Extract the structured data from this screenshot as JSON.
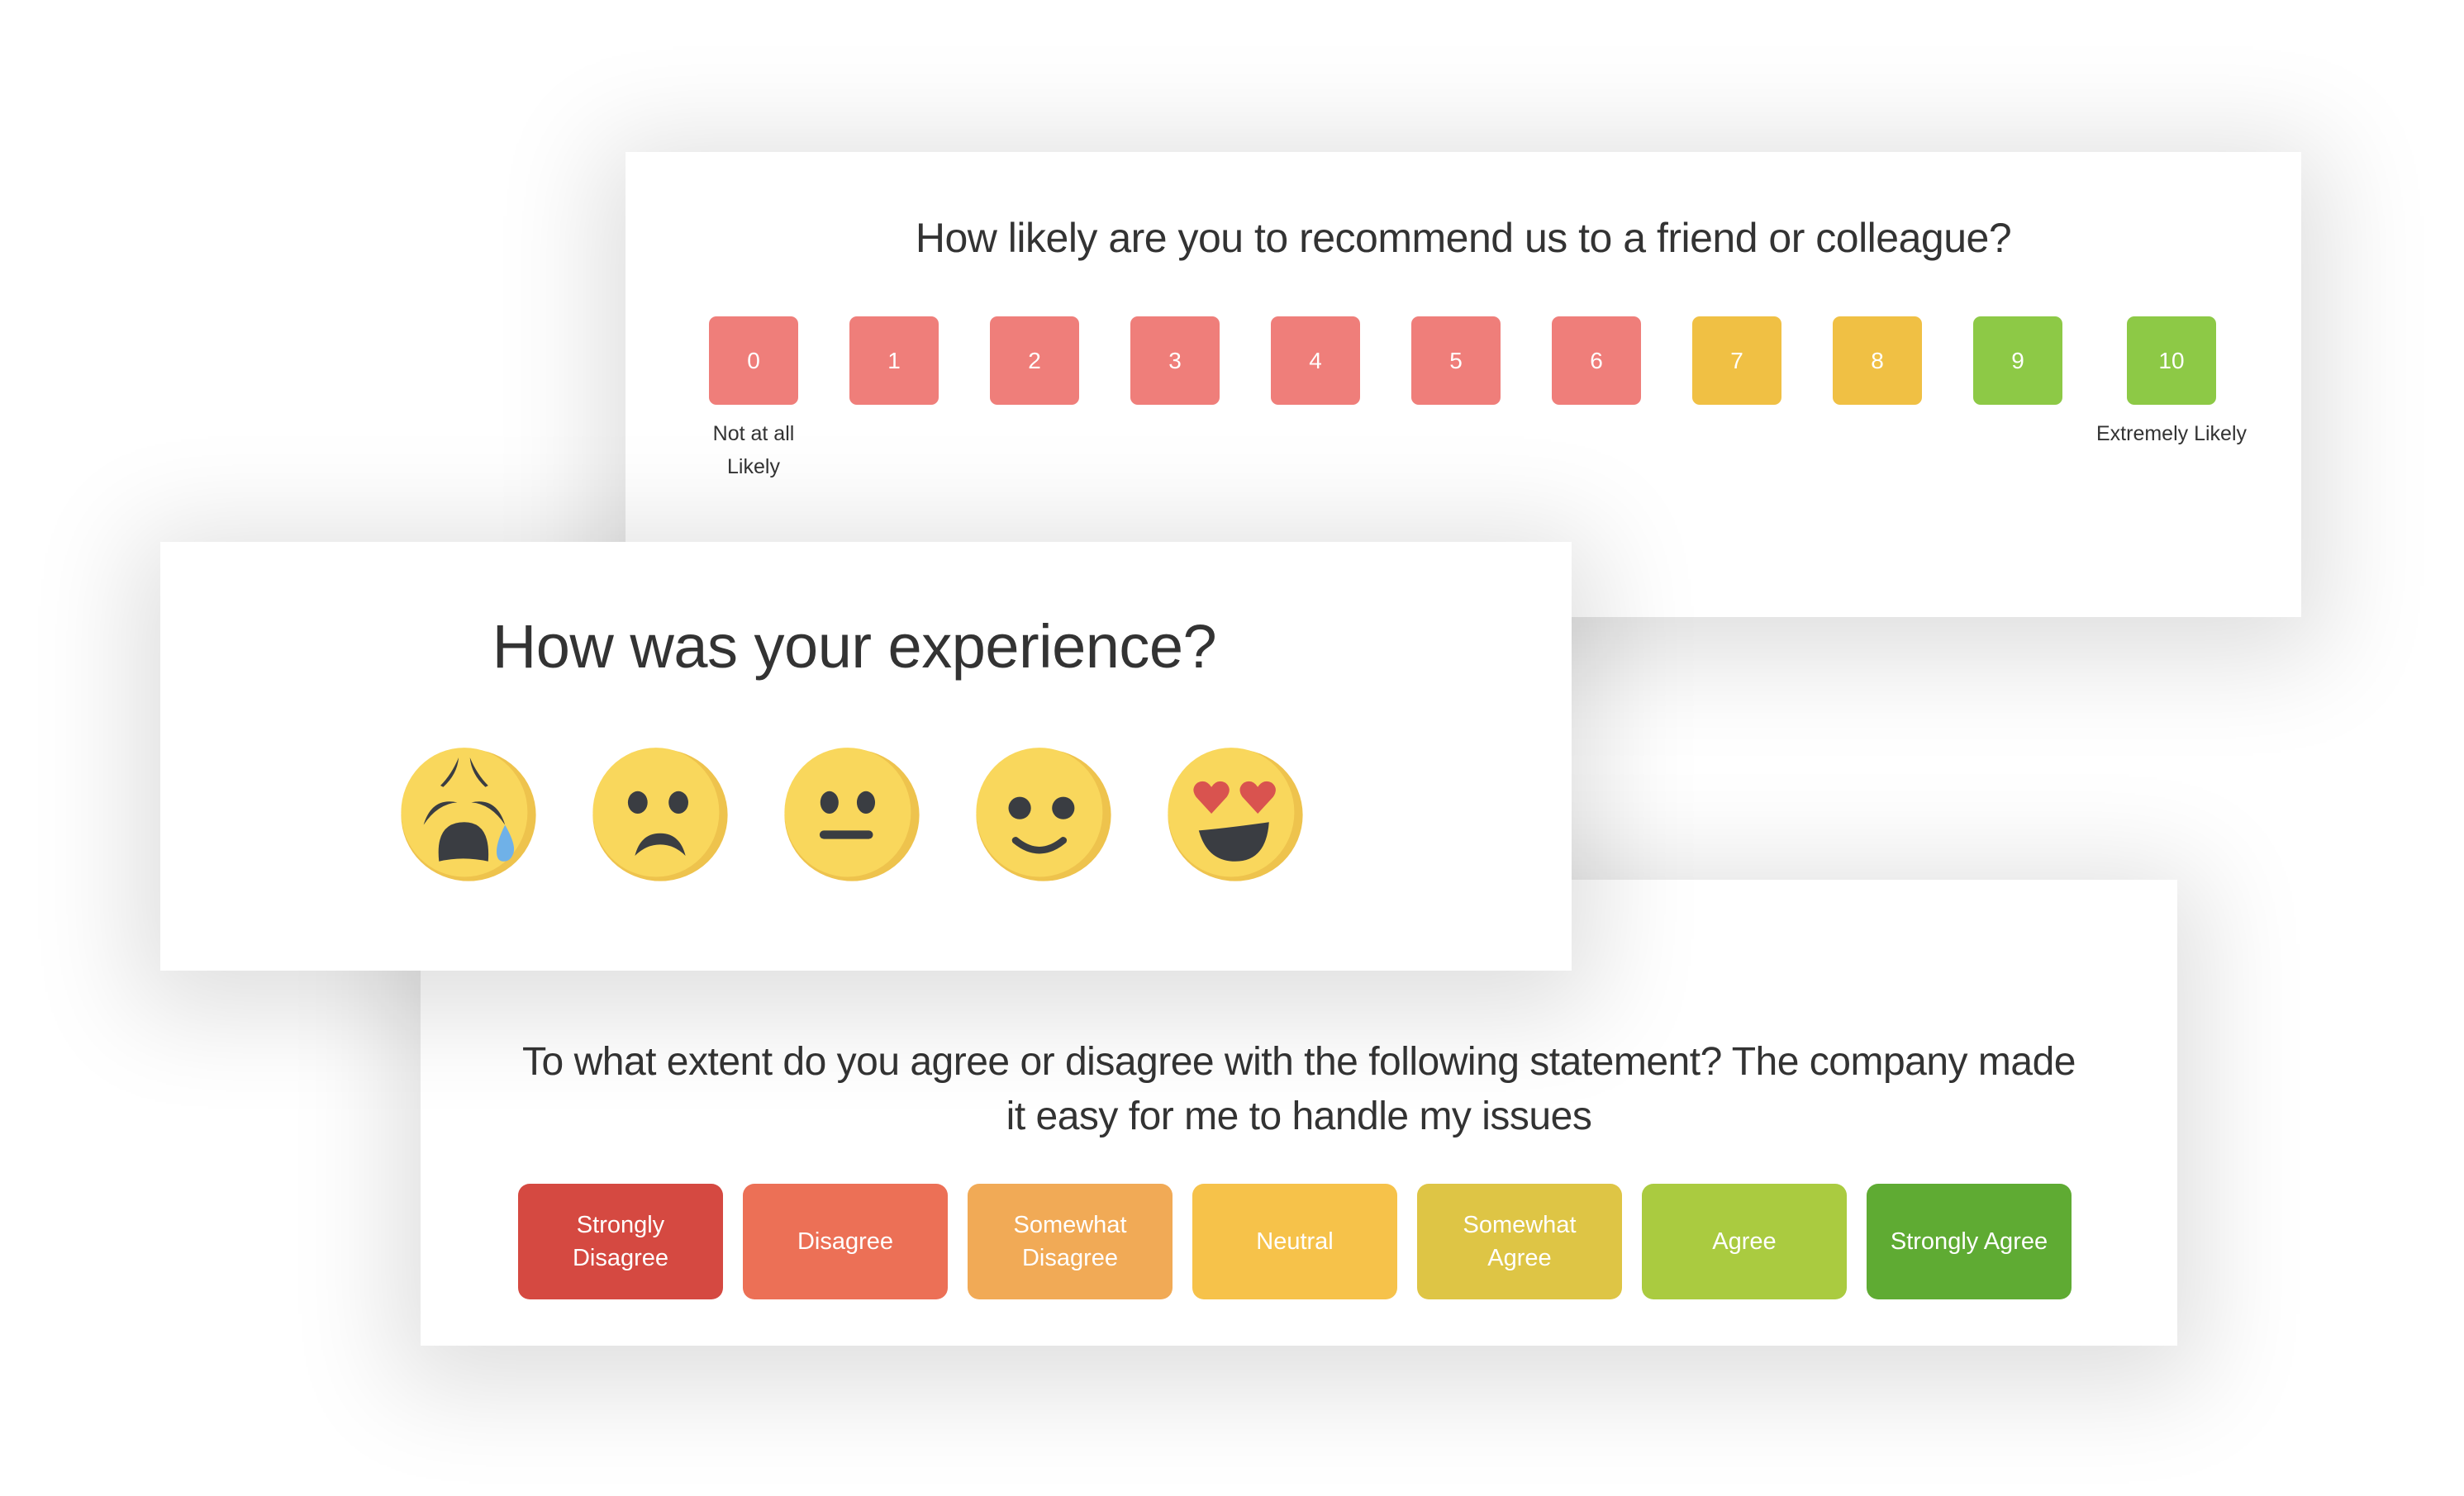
{
  "nps": {
    "question": "How likely are you to recommend us to a friend or colleague?",
    "options": [
      {
        "label": "0",
        "color": "#EF7E7A"
      },
      {
        "label": "1",
        "color": "#EF7E7A"
      },
      {
        "label": "2",
        "color": "#EF7E7A"
      },
      {
        "label": "3",
        "color": "#EF7E7A"
      },
      {
        "label": "4",
        "color": "#EF7E7A"
      },
      {
        "label": "5",
        "color": "#EF7E7A"
      },
      {
        "label": "6",
        "color": "#EF7E7A"
      },
      {
        "label": "7",
        "color": "#F0C044"
      },
      {
        "label": "8",
        "color": "#F0C044"
      },
      {
        "label": "9",
        "color": "#8DC946"
      },
      {
        "label": "10",
        "color": "#8DC946"
      }
    ],
    "low_label": "Not at all Likely",
    "high_label": "Extremely Likely"
  },
  "emoji_rating": {
    "question": "How was your experience?",
    "options": [
      {
        "icon": "weary-crying-face-icon",
        "meaning": "very bad"
      },
      {
        "icon": "frowning-face-icon",
        "meaning": "bad"
      },
      {
        "icon": "neutral-face-icon",
        "meaning": "neutral"
      },
      {
        "icon": "slightly-smiling-face-icon",
        "meaning": "good"
      },
      {
        "icon": "heart-eyes-face-icon",
        "meaning": "great"
      }
    ],
    "colors": {
      "face": "#F9D75C",
      "shade": "#EEC34D",
      "feature": "#3A3D42",
      "tear": "#6FB1E8",
      "heart": "#D9534F"
    }
  },
  "likert": {
    "question": "To what extent do you agree or disagree with the following statement? The company made it easy for me to handle my issues",
    "options": [
      {
        "label": "Strongly Disagree",
        "color": "#D54941"
      },
      {
        "label": "Disagree",
        "color": "#EC7056"
      },
      {
        "label": "Somewhat Disagree",
        "color": "#F1AA56"
      },
      {
        "label": "Neutral",
        "color": "#F6C24A"
      },
      {
        "label": "Somewhat Agree",
        "color": "#DEC545"
      },
      {
        "label": "Agree",
        "color": "#AACB40"
      },
      {
        "label": "Strongly Agree",
        "color": "#5FAB33"
      }
    ]
  }
}
